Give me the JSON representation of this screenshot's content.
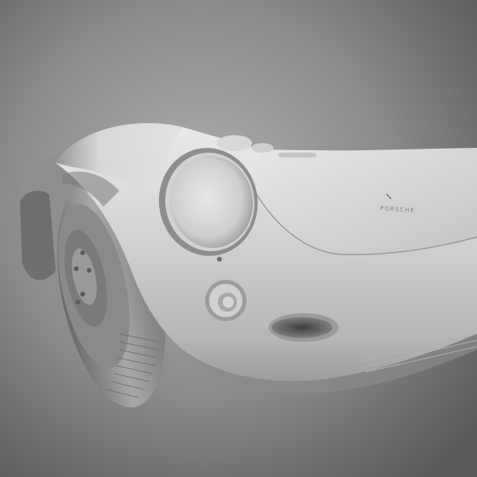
{
  "scene": {
    "subject": "car-render",
    "emblem_text": "PORSCHE",
    "colors": {
      "background_center": "#a9a9a9",
      "background_edge": "#5e5e5e",
      "body_light": "#e4e4e4",
      "body_mid": "#bdbdbd",
      "body_shadow": "#7d7d7d",
      "tire": "#9a9a9a",
      "tire_dark": "#5a5a5a"
    }
  }
}
